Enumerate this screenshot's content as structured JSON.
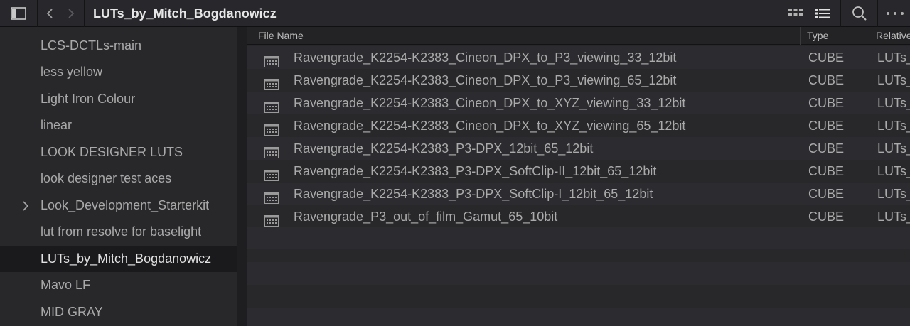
{
  "header": {
    "title": "LUTs_by_Mitch_Bogdanowicz"
  },
  "sidebar": {
    "items": [
      {
        "label": "LCS-DCTLs-main"
      },
      {
        "label": "less yellow"
      },
      {
        "label": "Light Iron Colour"
      },
      {
        "label": "linear"
      },
      {
        "label": "LOOK DESIGNER LUTS"
      },
      {
        "label": "look designer test aces"
      },
      {
        "label": "Look_Development_Starterkit"
      },
      {
        "label": "lut from resolve for baselight"
      },
      {
        "label": "LUTs_by_Mitch_Bogdanowicz",
        "selected": true
      },
      {
        "label": "Mavo LF"
      },
      {
        "label": "MID GRAY"
      }
    ]
  },
  "table": {
    "columns": {
      "name": "File Name",
      "type": "Type",
      "relative": "Relative"
    },
    "rows": [
      {
        "name": "Ravengrade_K2254-K2383_Cineon_DPX_to_P3_viewing_33_12bit",
        "type": "CUBE",
        "relative": "LUTs_"
      },
      {
        "name": "Ravengrade_K2254-K2383_Cineon_DPX_to_P3_viewing_65_12bit",
        "type": "CUBE",
        "relative": "LUTs_"
      },
      {
        "name": "Ravengrade_K2254-K2383_Cineon_DPX_to_XYZ_viewing_33_12bit",
        "type": "CUBE",
        "relative": "LUTs_"
      },
      {
        "name": "Ravengrade_K2254-K2383_Cineon_DPX_to_XYZ_viewing_65_12bit",
        "type": "CUBE",
        "relative": "LUTs_"
      },
      {
        "name": "Ravengrade_K2254-K2383_P3-DPX_12bit_65_12bit",
        "type": "CUBE",
        "relative": "LUTs_"
      },
      {
        "name": "Ravengrade_K2254-K2383_P3-DPX_SoftClip-II_12bit_65_12bit",
        "type": "CUBE",
        "relative": "LUTs_"
      },
      {
        "name": "Ravengrade_K2254-K2383_P3-DPX_SoftClip-I_12bit_65_12bit",
        "type": "CUBE",
        "relative": "LUTs_"
      },
      {
        "name": "Ravengrade_P3_out_of_film_Gamut_65_10bit",
        "type": "CUBE",
        "relative": "LUTs_"
      }
    ]
  },
  "icons": {
    "sidebar_toggle": "sidebar-toggle-icon",
    "back": "chevron-left-icon",
    "forward": "chevron-right-icon",
    "grid_view": "grid-view-icon",
    "list_view": "list-view-icon",
    "search": "search-icon",
    "more": "more-options-icon",
    "expand": "chevron-right-icon",
    "lut_file": "lut-file-icon"
  },
  "colors": {
    "background": "#28282b",
    "selected": "#1a1a1d",
    "text": "#aaaaaa"
  }
}
